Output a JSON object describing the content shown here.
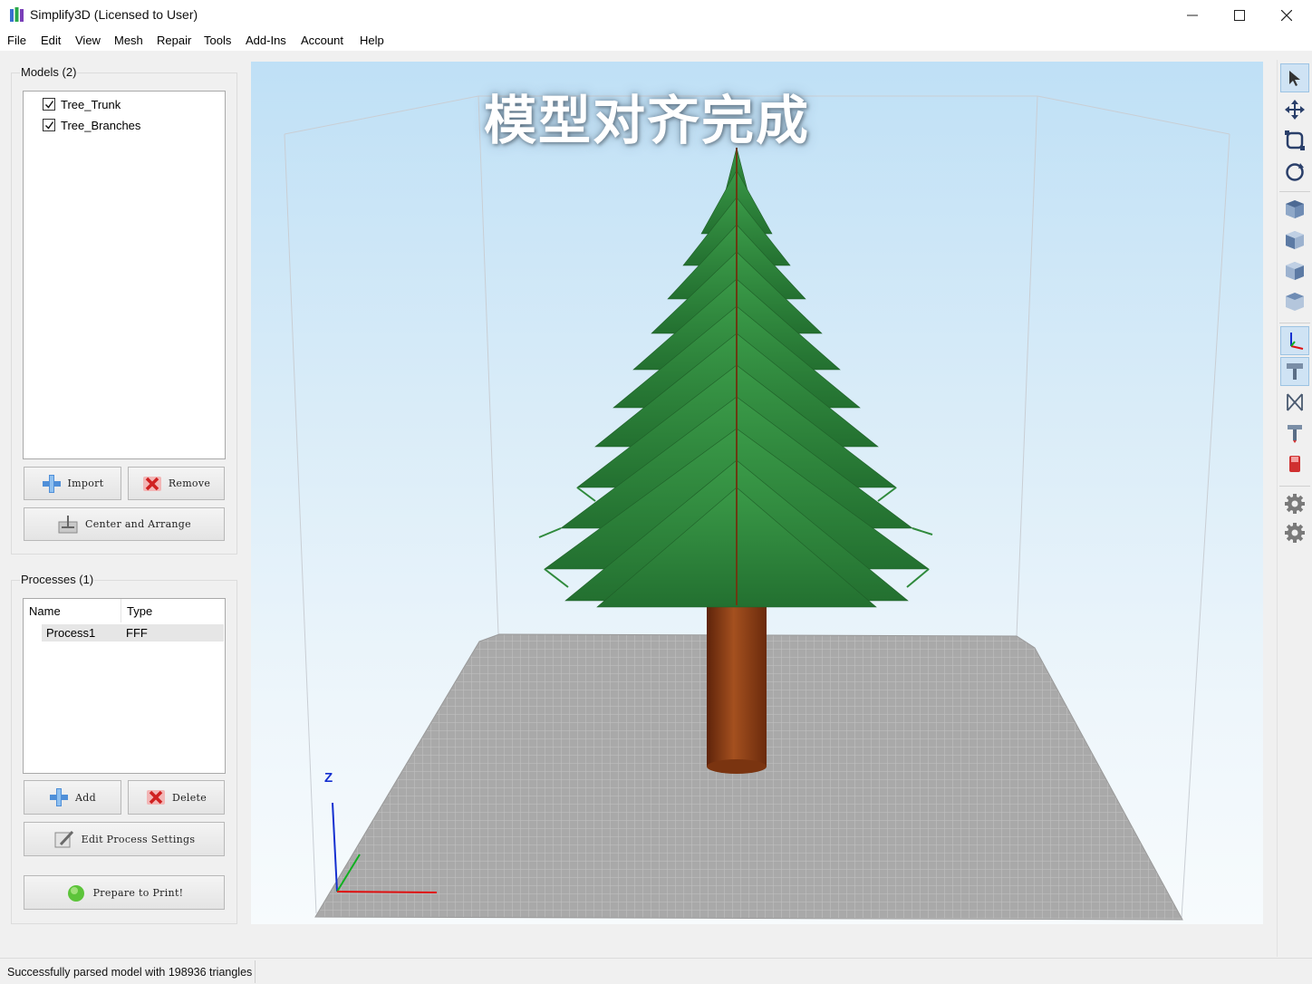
{
  "window": {
    "title": "Simplify3D (Licensed to User)",
    "controls": [
      "minimize-icon",
      "maximize-icon",
      "close-icon"
    ]
  },
  "menu": [
    "File",
    "Edit",
    "View",
    "Mesh",
    "Repair",
    "Tools",
    "Add-Ins",
    "Account",
    "Help"
  ],
  "models_panel": {
    "title": "Models (2)",
    "items": [
      {
        "label": "Tree_Trunk",
        "checked": true
      },
      {
        "label": "Tree_Branches",
        "checked": true
      }
    ],
    "import_label": "Import",
    "remove_label": "Remove",
    "center_label": "Center and Arrange"
  },
  "processes_panel": {
    "title": "Processes (1)",
    "columns": [
      "Name",
      "Type"
    ],
    "rows": [
      {
        "name": "Process1",
        "type": "FFF"
      }
    ],
    "add_label": "Add",
    "delete_label": "Delete",
    "edit_label": "Edit Process Settings",
    "prepare_label": "Prepare to Print!"
  },
  "viewport": {
    "caption": "模型对齐完成",
    "axis_z_label": "Z",
    "colors": {
      "bed": "#a9a9a9",
      "trunk": "#8b3a12",
      "foliage": "#2f8a3c",
      "axis_x": "#e01010",
      "axis_y": "#10b020",
      "axis_z": "#1530d0"
    }
  },
  "toolbar": {
    "tools": [
      "select-arrow-icon",
      "move-icon",
      "scale-icon",
      "rotate-icon",
      "view-cube-default-icon",
      "view-cube-front-icon",
      "view-cube-side-icon",
      "view-cube-top-icon",
      "show-axes-icon",
      "show-build-volume-icon",
      "cross-section-icon",
      "tool-head-icon",
      "print-bed-icon",
      "settings-gear-icon",
      "options-gear-icon"
    ]
  },
  "status": {
    "text": "Successfully parsed model with 198936 triangles"
  }
}
